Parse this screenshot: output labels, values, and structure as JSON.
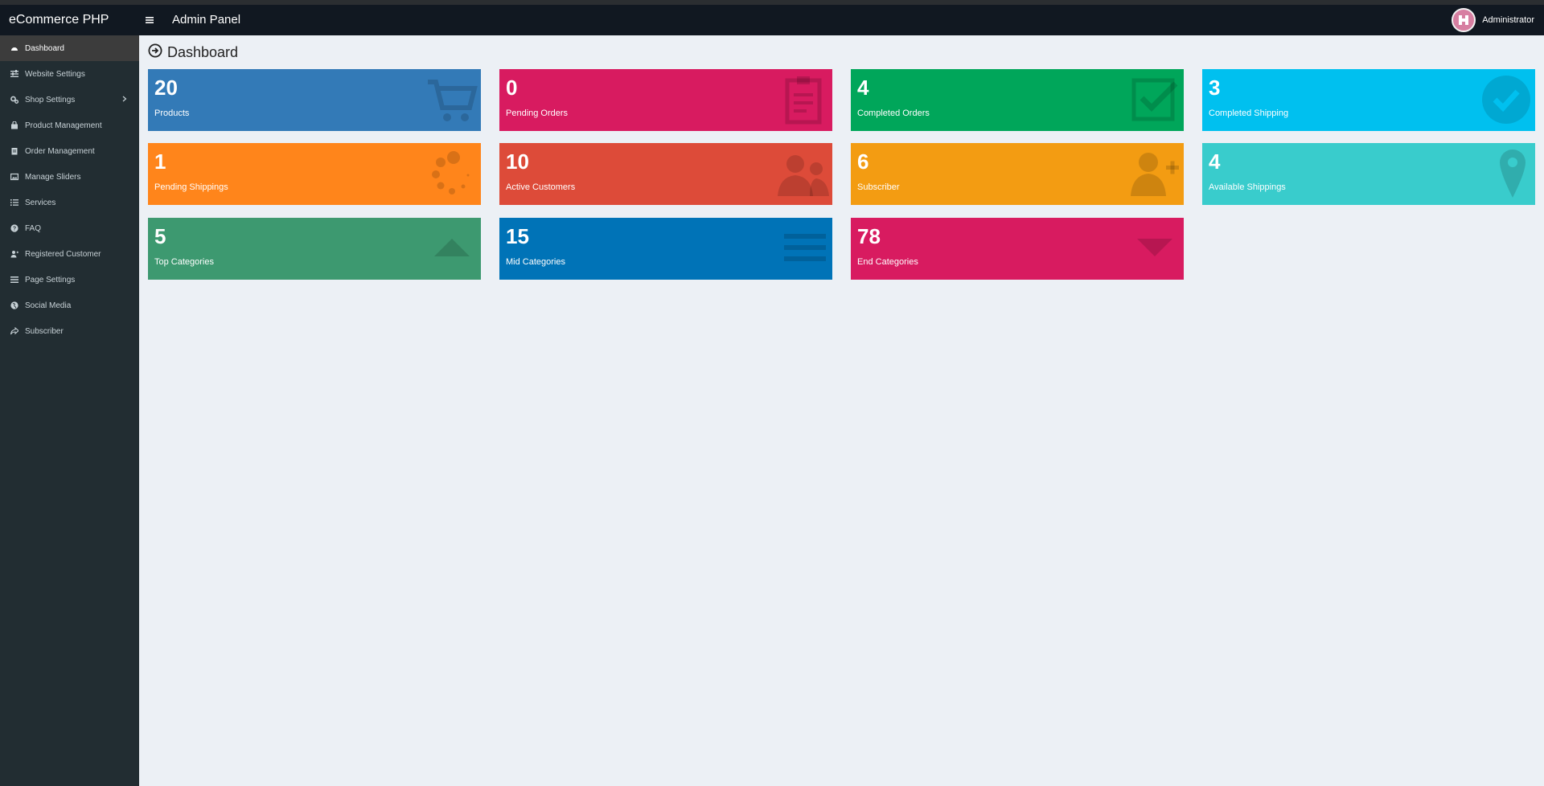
{
  "app": {
    "logo": "eCommerce PHP",
    "panel_title": "Admin Panel",
    "user_name": "Administrator"
  },
  "sidebar": {
    "items": [
      {
        "label": "Dashboard",
        "icon": "dashboard-icon",
        "active": true
      },
      {
        "label": "Website Settings",
        "icon": "sliders-icon"
      },
      {
        "label": "Shop Settings",
        "icon": "cogs-icon",
        "has_children": true
      },
      {
        "label": "Product Management",
        "icon": "shopping-bag-icon"
      },
      {
        "label": "Order Management",
        "icon": "clipboard-icon"
      },
      {
        "label": "Manage Sliders",
        "icon": "image-icon"
      },
      {
        "label": "Services",
        "icon": "list-icon"
      },
      {
        "label": "FAQ",
        "icon": "question-circle-icon"
      },
      {
        "label": "Registered Customer",
        "icon": "user-plus-icon"
      },
      {
        "label": "Page Settings",
        "icon": "bars-icon"
      },
      {
        "label": "Social Media",
        "icon": "globe-icon"
      },
      {
        "label": "Subscriber",
        "icon": "share-icon"
      }
    ]
  },
  "main": {
    "heading": "Dashboard",
    "tiles": [
      {
        "value": "20",
        "label": "Products",
        "color": "#337ab7",
        "icon": "shopping-cart-icon"
      },
      {
        "value": "0",
        "label": "Pending Orders",
        "color": "#d81b60",
        "icon": "clipboard-icon"
      },
      {
        "value": "4",
        "label": "Completed Orders",
        "color": "#00a65a",
        "icon": "check-square-icon"
      },
      {
        "value": "3",
        "label": "Completed Shipping",
        "color": "#00c0ef",
        "icon": "check-circle-icon"
      },
      {
        "value": "1",
        "label": "Pending Shippings",
        "color": "#ff851b",
        "icon": "spinner-icon"
      },
      {
        "value": "10",
        "label": "Active Customers",
        "color": "#dd4b39",
        "icon": "users-icon"
      },
      {
        "value": "6",
        "label": "Subscriber",
        "color": "#f39c12",
        "icon": "user-plus-icon"
      },
      {
        "value": "4",
        "label": "Available Shippings",
        "color": "#39cccc",
        "icon": "map-marker-icon"
      },
      {
        "value": "5",
        "label": "Top Categories",
        "color": "#3d9970",
        "icon": "caret-up-icon"
      },
      {
        "value": "15",
        "label": "Mid Categories",
        "color": "#0073b7",
        "icon": "bars-icon"
      },
      {
        "value": "78",
        "label": "End Categories",
        "color": "#d81b60",
        "icon": "caret-down-icon"
      }
    ]
  }
}
